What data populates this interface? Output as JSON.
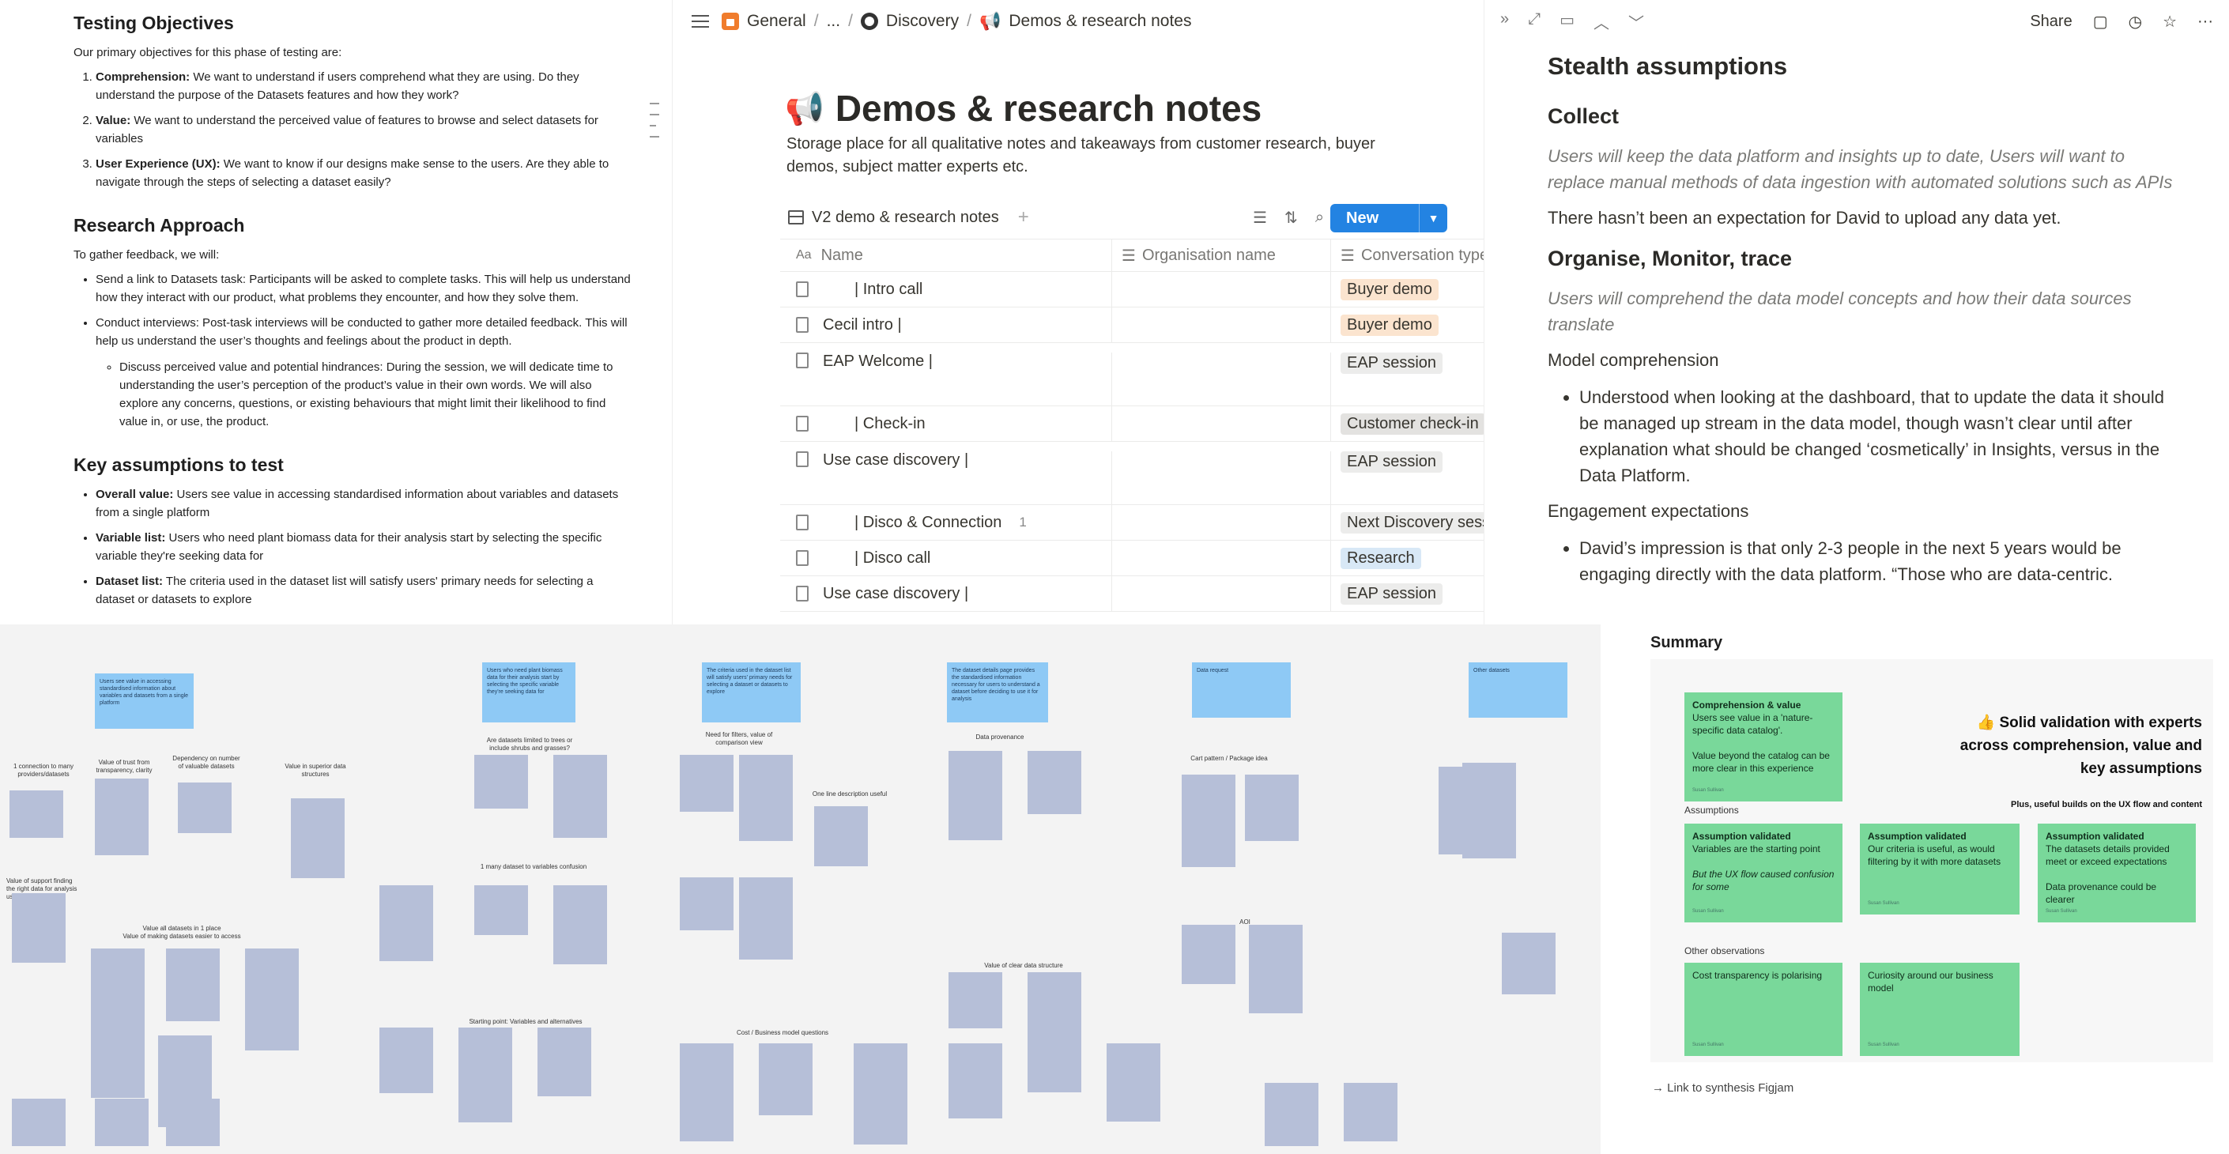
{
  "left_doc": {
    "testing_objectives": {
      "title": "Testing Objectives",
      "intro": "Our primary objectives for this phase of testing are:",
      "items": [
        {
          "label": "Comprehension:",
          "text": " We want to understand if users comprehend what they are using. Do they understand the purpose of the Datasets features and how they work?"
        },
        {
          "label": "Value:",
          "text": " We want to understand the perceived value of features to browse and select datasets for variables"
        },
        {
          "label": "User Experience (UX):",
          "text": " We want to know if our designs make sense to the users. Are they able to navigate through the steps of selecting a dataset easily?"
        }
      ]
    },
    "research_approach": {
      "title": "Research Approach",
      "intro": "To gather feedback, we will:",
      "items": [
        "Send a link to Datasets task: Participants will be asked to complete tasks. This will help us understand how they interact with our product, what problems they encounter, and how they solve them.",
        "Conduct interviews: Post-task interviews will be conducted to gather more detailed feedback. This will help us understand the user’s thoughts and feelings about the product in depth."
      ],
      "sub_item": "Discuss perceived value and potential hindrances: During the session, we will dedicate time to understanding the user’s perception of the product’s value in their own words. We will also explore any concerns, questions, or existing behaviours that might limit their likelihood to find value in, or use, the product."
    },
    "key_assumptions": {
      "title": "Key assumptions to test",
      "items": [
        {
          "label": "Overall value:",
          "text": " Users see value in accessing standardised information about variables and datasets from a single platform"
        },
        {
          "label": "Variable list:",
          "text": " Users who need plant biomass data for their analysis start by selecting the specific variable they're seeking data for"
        },
        {
          "label": "Dataset list:",
          "text": " The criteria used in the dataset list will satisfy users' primary needs for selecting a dataset or datasets to explore"
        }
      ]
    }
  },
  "notion": {
    "breadcrumbs": [
      "General",
      "...",
      "Discovery",
      "Demos & research notes"
    ],
    "page_title": "Demos & research notes",
    "description": "Storage place for all qualitative notes and takeaways from customer research, buyer demos, subject matter experts etc.",
    "database_name": "V2 demo & research notes",
    "new_label": "New",
    "columns": [
      "Name",
      "Organisation name",
      "Conversation type"
    ],
    "rows": [
      {
        "name": "| Intro call",
        "org": "",
        "type": "Buyer demo",
        "color": "#fbe4cf",
        "tall": false,
        "indent": true,
        "comment": ""
      },
      {
        "name": "Cecil intro |",
        "org": "",
        "type": "Buyer demo",
        "color": "#fbe4cf",
        "tall": false,
        "indent": false,
        "comment": ""
      },
      {
        "name": "EAP Welcome |",
        "org": "",
        "type": "EAP session",
        "color": "#ececeb",
        "tall": true,
        "indent": false,
        "comment": ""
      },
      {
        "name": "| Check-in",
        "org": "",
        "type": "Customer check-in",
        "color": "#e3e2e0",
        "tall": false,
        "indent": true,
        "comment": ""
      },
      {
        "name": "Use case discovery |",
        "org": "",
        "type": "EAP session",
        "color": "#ececeb",
        "tall": true,
        "indent": false,
        "comment": ""
      },
      {
        "name": "| Disco & Connection",
        "org": "",
        "type": "Next Discovery session",
        "color": "#ececeb",
        "tall": false,
        "indent": true,
        "comment": "1"
      },
      {
        "name": "| Disco call",
        "org": "",
        "type": "Research",
        "color": "#d8e8f6",
        "tall": false,
        "indent": true,
        "comment": ""
      },
      {
        "name": "Use case discovery |",
        "org": "",
        "type": "EAP session",
        "color": "#ececeb",
        "tall": false,
        "indent": false,
        "comment": ""
      }
    ]
  },
  "right_doc": {
    "toolbar": {
      "share": "Share"
    },
    "title": "Stealth assumptions",
    "collect": {
      "heading": "Collect",
      "quote": "Users will keep the data platform and insights up to date, Users will want to replace manual methods of data ingestion with automated solutions such as APIs",
      "text": "There hasn’t been an expectation for David to upload any data yet."
    },
    "organise": {
      "heading": "Organise, Monitor, trace",
      "quote": "Users will comprehend the data model concepts and how their data sources translate",
      "sub1": "Model comprehension",
      "bullet1": "Understood when looking at the dashboard, that to update the data it should be managed up stream in the data model, though wasn’t clear until after explanation what should be changed ‘cosmetically’ in Insights, versus in the Data Platform.",
      "sub2": "Engagement expectations",
      "bullet2": "David’s impression is that only 2-3 people in the next 5 years would be engaging directly with the data platform. “Those who are data-centric."
    }
  },
  "board": {
    "blue_notes": [
      "Users see value in accessing standardised information about variables and datasets from a single platform",
      "Users who need plant biomass data for their analysis start by selecting the specific variable they're seeking data for",
      "The criteria used in the dataset list will satisfy users' primary needs for selecting a dataset or datasets to explore",
      "The dataset details page provides the standardised information necessary for users to understand a dataset before deciding to use it for analysis",
      "Data request",
      "Other datasets"
    ],
    "labels": [
      "1 connection to many providers/datasets",
      "Value of trust from transparency, clarity",
      "Dependency on number of valuable datasets",
      "Value in superior data structures",
      "Are datasets limited to trees or include shrubs and grasses?",
      "Need for filters, value of comparison view",
      "One line description useful",
      "Data provenance",
      "Cart pattern / Package idea",
      "Value of support finding the right data for analysis use cases",
      "Value all datasets in 1 place",
      "Value of making datasets easier to access",
      "1 many dataset to variables confusion",
      "Starting point: Variables and alternatives",
      "Cost / Business model questions",
      "Value of clear data structure",
      "AOI"
    ]
  },
  "summary": {
    "title": "Summary",
    "top_note": {
      "title": "Comprehension & value",
      "text": "Users see value in a 'nature-specific data catalog'.",
      "text2": "Value beyond the catalog can be more clear in this experience"
    },
    "headline": "Solid validation with experts across comprehension, value and key assumptions",
    "subline": "Plus, useful builds on the UX flow and content",
    "assumptions_label": "Assumptions",
    "assumptions": [
      {
        "title": "Assumption validated",
        "text": "Variables are the starting point",
        "extra": "But the UX flow caused confusion for some"
      },
      {
        "title": "Assumption validated",
        "text": "Our criteria is useful, as would filtering by it with more datasets",
        "extra": ""
      },
      {
        "title": "Assumption validated",
        "text": "The datasets details provided meet or exceed expectations",
        "extra": "Data provenance could be clearer"
      }
    ],
    "other_label": "Other observations",
    "other": [
      "Cost transparency is polarising",
      "Curiosity around our business model"
    ],
    "link": "→ Link to synthesis Figjam"
  }
}
